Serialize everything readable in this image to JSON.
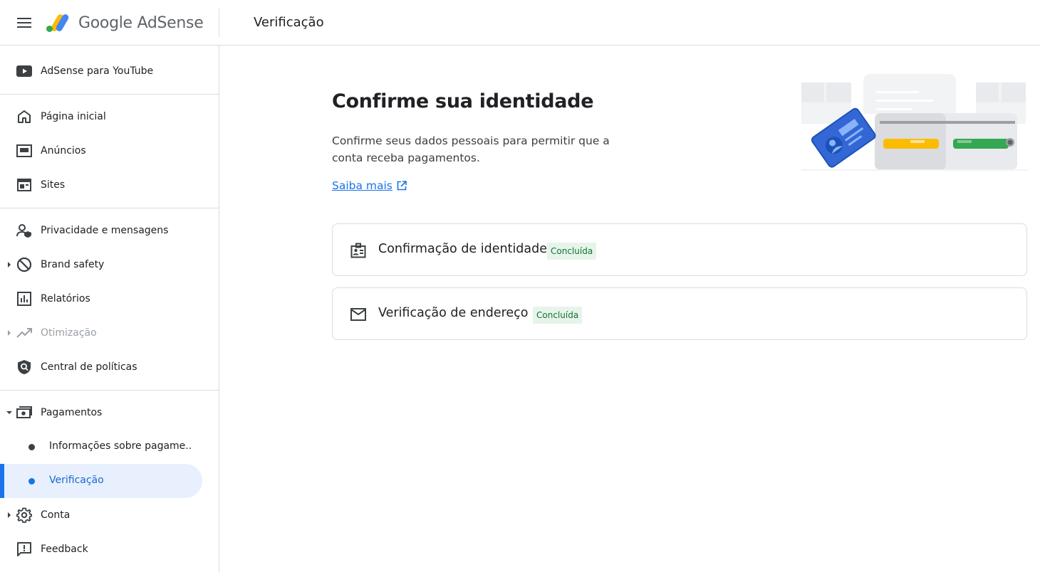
{
  "header": {
    "app_name": "Google AdSense",
    "page_title": "Verificação"
  },
  "sidebar": {
    "items": [
      {
        "label": "AdSense para YouTube",
        "icon": "youtube-icon"
      },
      {
        "label": "Página inicial",
        "icon": "home-icon"
      },
      {
        "label": "Anúncios",
        "icon": "ads-icon"
      },
      {
        "label": "Sites",
        "icon": "sites-icon"
      },
      {
        "label": "Privacidade e mensagens",
        "icon": "privacy-icon"
      },
      {
        "label": "Brand safety",
        "icon": "block-icon"
      },
      {
        "label": "Relatórios",
        "icon": "reports-icon"
      },
      {
        "label": "Otimização",
        "icon": "trending-icon"
      },
      {
        "label": "Central de políticas",
        "icon": "policy-shield-icon"
      },
      {
        "label": "Pagamentos",
        "icon": "payments-icon"
      },
      {
        "label": "Conta",
        "icon": "gear-icon"
      },
      {
        "label": "Feedback",
        "icon": "feedback-icon"
      }
    ],
    "payments_sub": [
      {
        "label": "Informações sobre pagame..."
      },
      {
        "label": "Verificação",
        "active": true
      }
    ]
  },
  "main": {
    "title": "Confirme sua identidade",
    "description": "Confirme seus dados pessoais para permitir que a conta receba pagamentos.",
    "learn_more": "Saiba mais",
    "cards": [
      {
        "title": "Confirmação de identidade",
        "status": "Concluída",
        "icon": "id-badge-icon"
      },
      {
        "title": "Verificação de endereço",
        "status": "Concluída",
        "icon": "mail-icon"
      }
    ]
  },
  "colors": {
    "accent": "#1a73e8",
    "success_bg": "#e6f4ea",
    "success_text": "#137333",
    "border": "#dadce0"
  }
}
